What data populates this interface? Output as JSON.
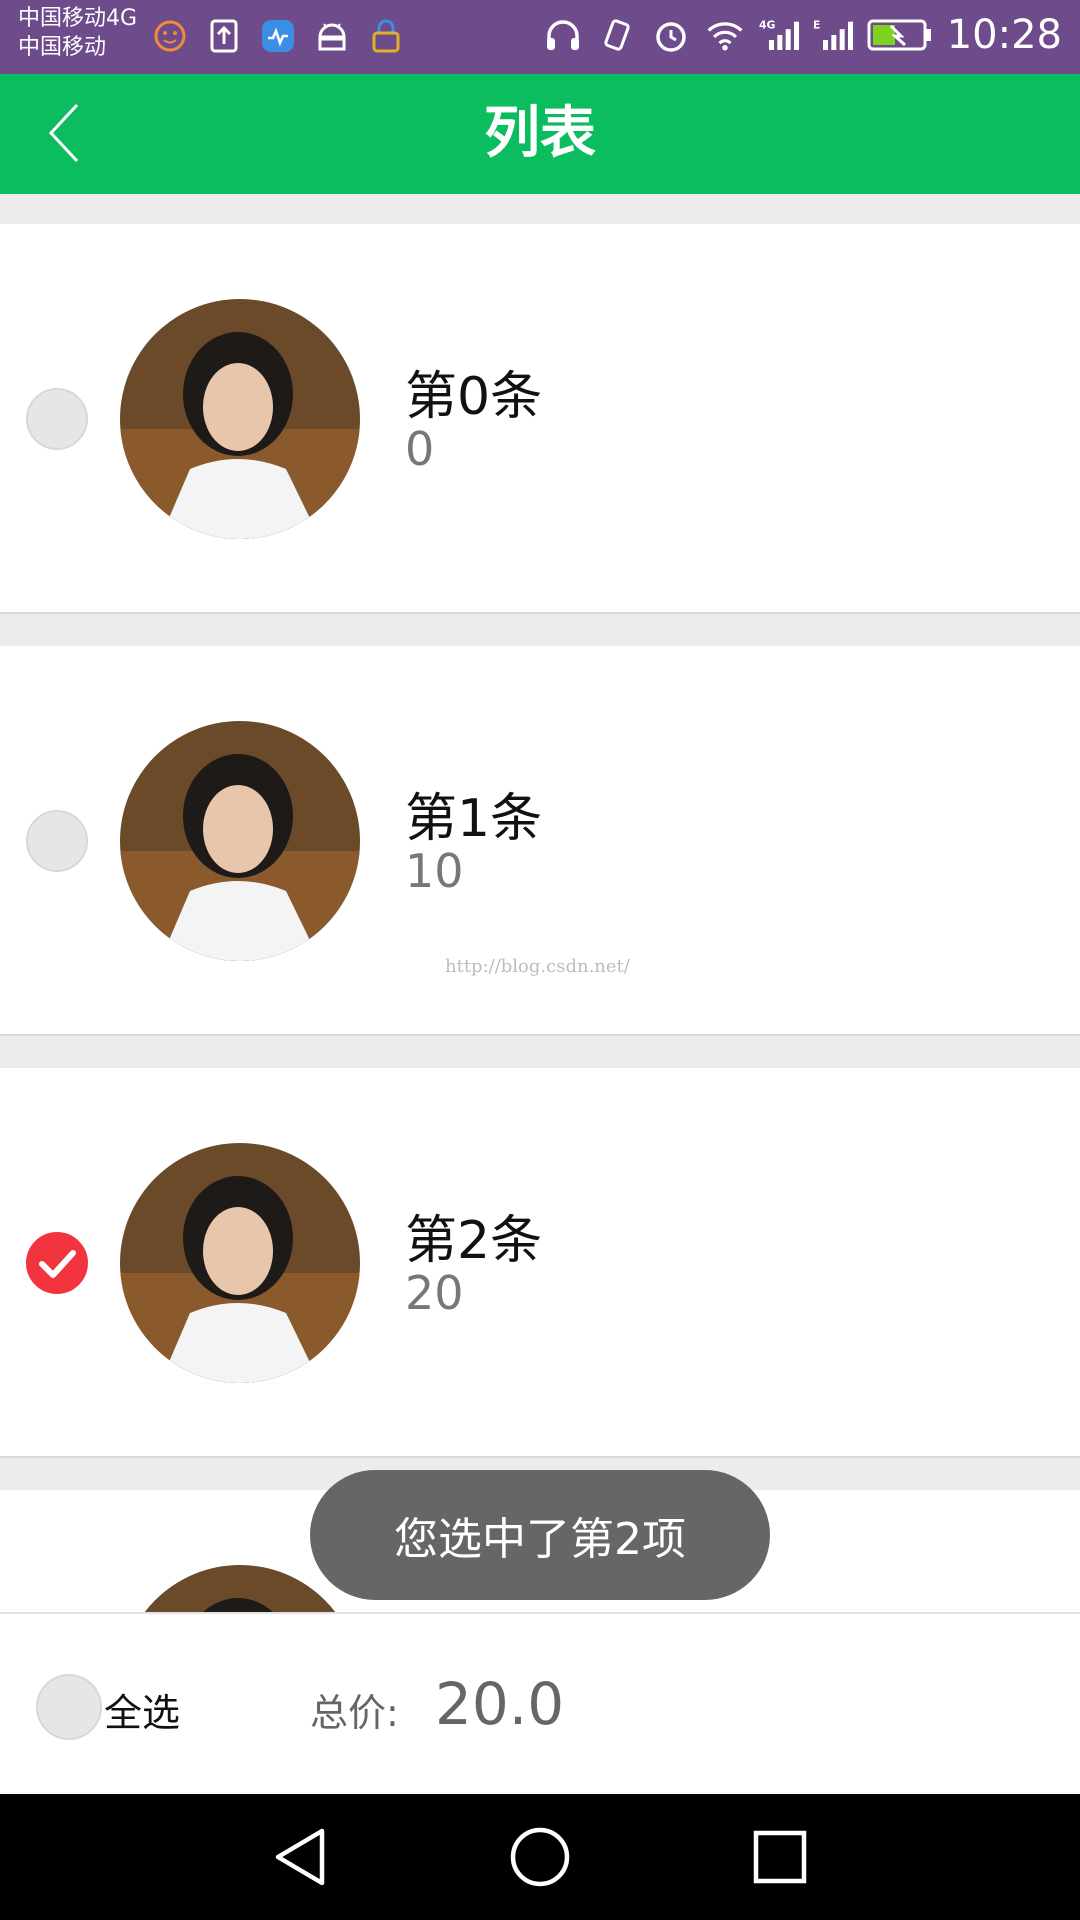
{
  "status_bar": {
    "carrier_line1": "中国移动4G",
    "carrier_line2": "中国移动",
    "time": "10:28",
    "left_icons": [
      "smiley-icon",
      "upload-icon",
      "health-icon",
      "android-icon",
      "lock-icon"
    ],
    "right_icons": [
      "headphones-icon",
      "vibrate-icon",
      "alarm-icon",
      "wifi-icon",
      "signal-4g-icon",
      "signal-e-icon",
      "battery-charging-icon"
    ]
  },
  "app_bar": {
    "title": "列表",
    "color": "#0bbd5e"
  },
  "list": {
    "items": [
      {
        "title": "第0条",
        "price": "0",
        "checked": false
      },
      {
        "title": "第1条",
        "price": "10",
        "checked": false
      },
      {
        "title": "第2条",
        "price": "20",
        "checked": true
      }
    ],
    "watermark": "http://blog.csdn.net/"
  },
  "toast": {
    "text": "您选中了第2项"
  },
  "footer": {
    "select_all_label": "全选",
    "total_label": "总价:",
    "total_value": "20.0"
  },
  "colors": {
    "accent_green": "#0bbd5e",
    "check_red": "#f2343f",
    "status_purple": "#6e4b8a"
  }
}
